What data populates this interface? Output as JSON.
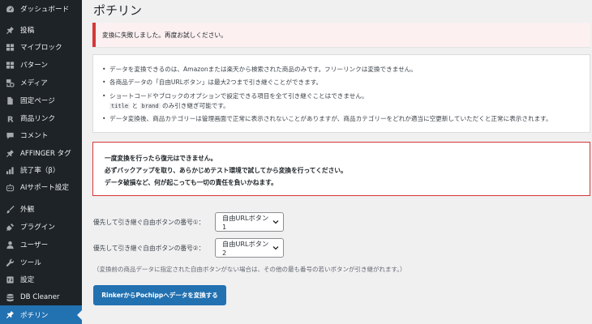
{
  "page_title": "ポチリン",
  "sidebar": {
    "items": [
      {
        "label": "ダッシュボード",
        "icon": "dashboard-icon"
      },
      {
        "label": "投稿",
        "icon": "pin-icon"
      },
      {
        "label": "マイブロック",
        "icon": "grid-icon"
      },
      {
        "label": "パターン",
        "icon": "grid-icon"
      },
      {
        "label": "メディア",
        "icon": "media-icon"
      },
      {
        "label": "固定ページ",
        "icon": "page-icon"
      },
      {
        "label": "商品リンク",
        "icon": "r-icon"
      },
      {
        "label": "コメント",
        "icon": "comment-icon"
      },
      {
        "label": "AFFINGER タグ",
        "icon": "pin-icon"
      },
      {
        "label": "読了率（β）",
        "icon": "chart-icon"
      },
      {
        "label": "AIサポート設定",
        "icon": "robot-icon"
      },
      {
        "label": "外観",
        "icon": "brush-icon"
      },
      {
        "label": "プラグイン",
        "icon": "plugin-icon"
      },
      {
        "label": "ユーザー",
        "icon": "user-icon"
      },
      {
        "label": "ツール",
        "icon": "wrench-icon"
      },
      {
        "label": "設定",
        "icon": "settings-icon"
      },
      {
        "label": "DB Cleaner",
        "icon": "database-icon"
      },
      {
        "label": "ポチリン",
        "icon": "pin-icon",
        "active": true
      }
    ]
  },
  "error_notice": "変換に失敗しました。再度お試しください。",
  "info": {
    "item1": "データを変換できるのは、Amazonまたは楽天から検索された商品のみです。フリーリンクは変換できません。",
    "item2": "各商品データの「自由URLボタン」は最大2つまで引き継ぐことができます。",
    "item3_line1": "ショートコードやブロックのオプションで設定できる項目を全て引き継ぐことはできません。",
    "item3_code1": "title",
    "item3_and": " と ",
    "item3_code2": "brand",
    "item3_tail": " のみ引き継ぎ可能です。",
    "item4": "データ変換後、商品カテゴリーは管理画面で正常に表示されないことがありますが、商品カテゴリーをどれか適当に空更新していただくと正常に表示されます。"
  },
  "warning": {
    "line1": "一度変換を行ったら復元はできません。",
    "line2": "必ずバックアップを取り、あらかじめテスト環境で試してから変換を行ってください。",
    "line3": "データ破損など、何が起こっても一切の責任を負いかねます。"
  },
  "form": {
    "label1": "優先して引き継ぐ自由ボタンの番号①：",
    "select1": "自由URLボタン1",
    "label2": "優先して引き継ぐ自由ボタンの番号②：",
    "select2": "自由URLボタン2",
    "note": "（変換前の商品データに指定された自由ボタンがない場合は、その他の最も番号の若いボタンが引き継がれます。）",
    "submit": "RinkerからPochippへデータを変換する"
  },
  "colors": {
    "sidebar_bg": "#1d2327",
    "accent": "#2271b1",
    "error": "#d63638",
    "page_bg": "#f0f0f1"
  }
}
